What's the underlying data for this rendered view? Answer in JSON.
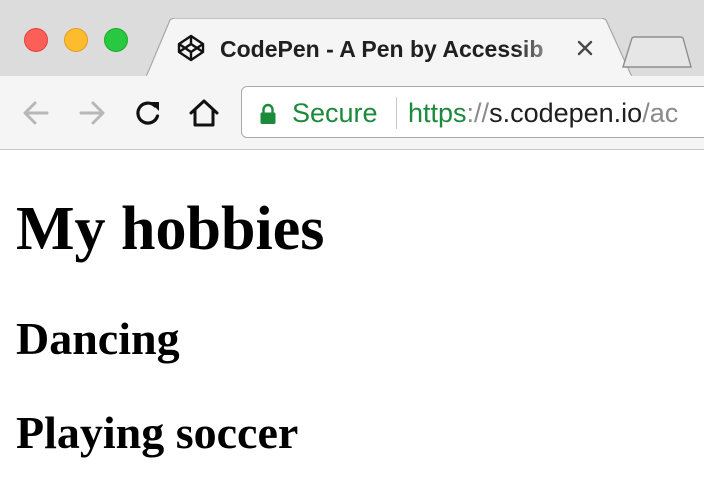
{
  "browser": {
    "tab": {
      "title": "CodePen - A Pen by Accessib",
      "favicon": "codepen-icon"
    },
    "address_bar": {
      "security_label": "Secure",
      "url_scheme": "https",
      "url_separator": "://",
      "url_host": "s.codepen.io",
      "url_path": "/ac"
    },
    "colors": {
      "secure_green": "#1b8a3a",
      "traffic_close": "#fc5f57",
      "traffic_minimize": "#fdbc2e",
      "traffic_maximize": "#28c840"
    }
  },
  "page": {
    "heading": "My hobbies",
    "hobbies": [
      "Dancing",
      "Playing soccer"
    ]
  }
}
